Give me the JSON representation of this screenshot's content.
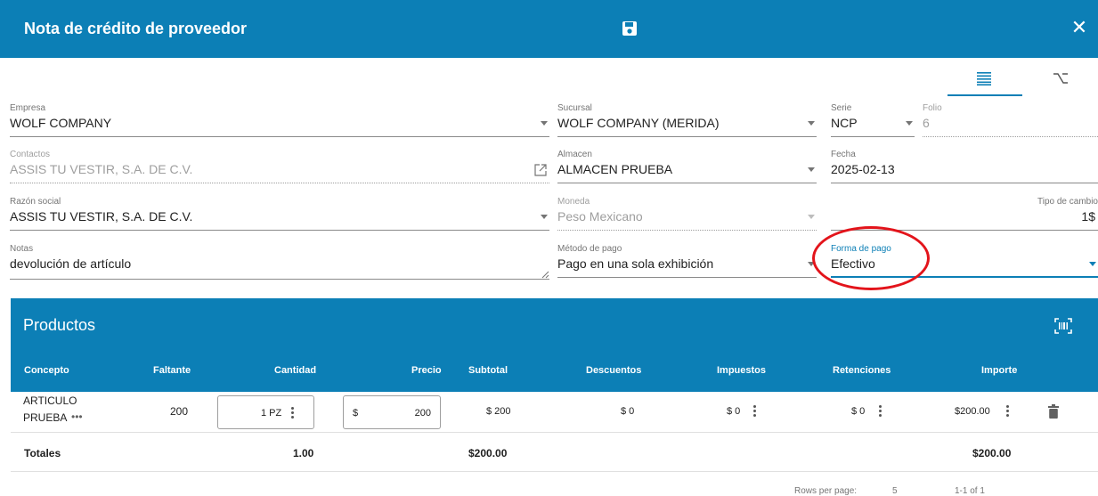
{
  "header": {
    "title": "Nota de crédito de proveedor",
    "close": "✕"
  },
  "form": {
    "empresa": {
      "label": "Empresa",
      "value": "WOLF COMPANY"
    },
    "sucursal": {
      "label": "Sucursal",
      "value": "WOLF COMPANY (MERIDA)"
    },
    "serie": {
      "label": "Serie",
      "value": "NCP"
    },
    "folio": {
      "label": "Folio",
      "value": "6"
    },
    "contactos": {
      "label": "Contactos",
      "value": "ASSIS TU VESTIR, S.A. DE C.V."
    },
    "almacen": {
      "label": "Almacen",
      "value": "ALMACEN PRUEBA"
    },
    "fecha": {
      "label": "Fecha",
      "value": "2025-02-13"
    },
    "razon_social": {
      "label": "Razón social",
      "value": "ASSIS TU VESTIR, S.A. DE C.V."
    },
    "moneda": {
      "label": "Moneda",
      "value": "Peso Mexicano"
    },
    "tipo_cambio": {
      "label": "Tipo de cambio",
      "value": "1$"
    },
    "notas": {
      "label": "Notas",
      "value": "devolución de artículo"
    },
    "metodo_pago": {
      "label": "Método de pago",
      "value": "Pago en una sola exhibición"
    },
    "forma_pago": {
      "label": "Forma de pago",
      "value": "Efectivo"
    }
  },
  "productos": {
    "title": "Productos",
    "columns": {
      "concepto": "Concepto",
      "faltante": "Faltante",
      "cantidad": "Cantidad",
      "precio": "Precio",
      "subtotal": "Subtotal",
      "descuentos": "Descuentos",
      "impuestos": "Impuestos",
      "retenciones": "Retenciones",
      "importe": "Importe"
    },
    "row": {
      "concepto_line1": "ARTICULO",
      "concepto_line2": "PRUEBA",
      "more": "•••",
      "faltante": "200",
      "cantidad": "1 PZ",
      "precio_symbol": "$",
      "precio": "200",
      "subtotal": "$ 200",
      "descuentos": "$ 0",
      "impuestos": "$ 0",
      "retenciones": "$ 0",
      "importe": "$200.00"
    },
    "totales": {
      "label": "Totales",
      "cantidad": "1.00",
      "subtotal": "$200.00",
      "importe": "$200.00"
    }
  },
  "pagination": {
    "rows_per_page_label": "Rows per page:",
    "rows_per_page": "5",
    "range": "1-1 of 1"
  },
  "colors": {
    "primary": "#0c7fb6",
    "annotation": "#e3141b"
  }
}
